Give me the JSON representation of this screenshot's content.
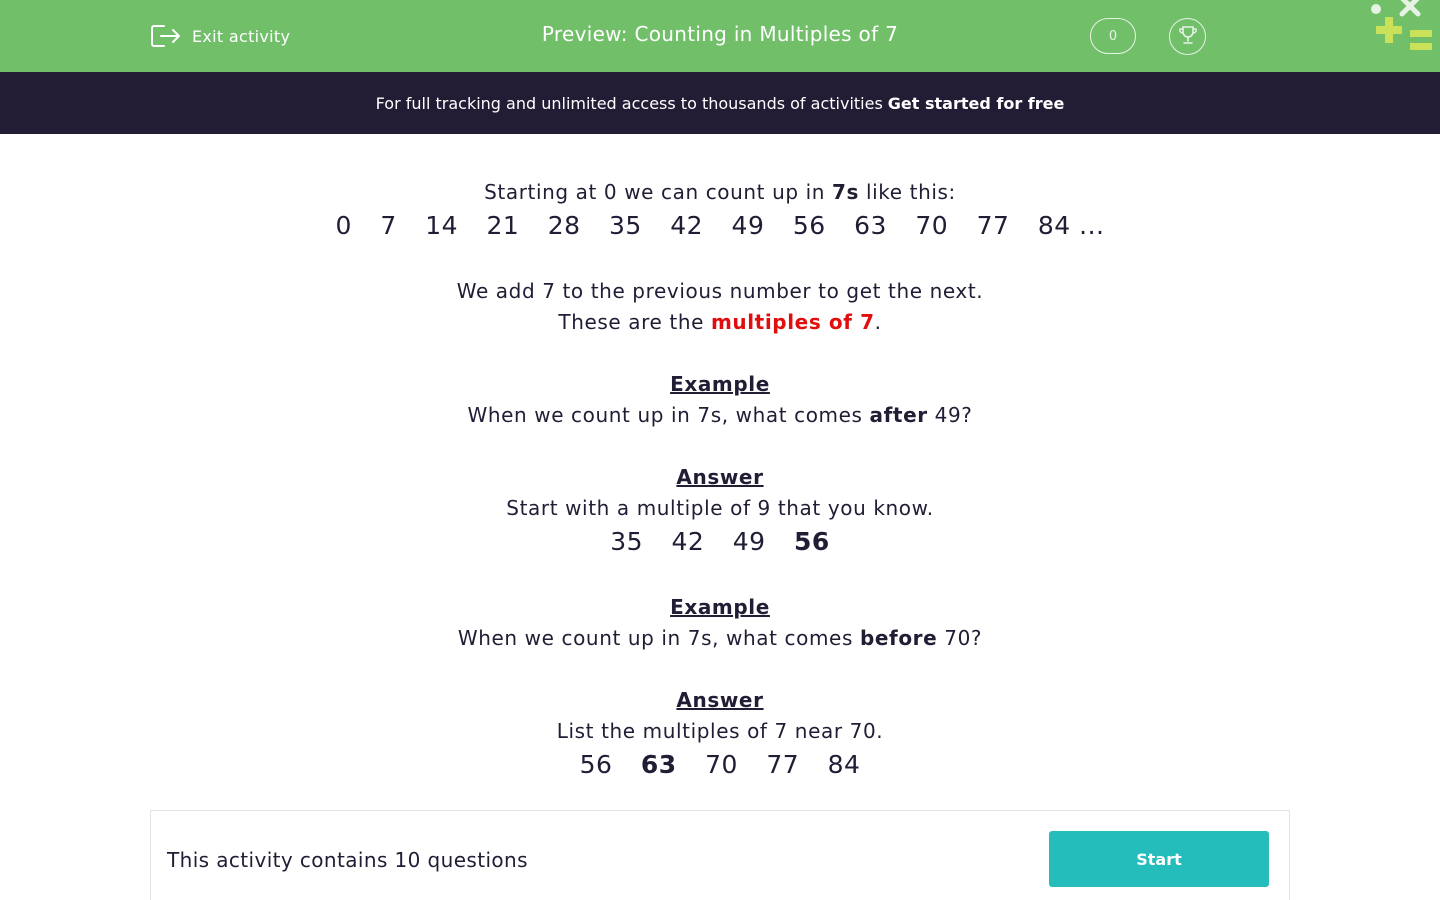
{
  "header": {
    "exit_label": "Exit activity",
    "title": "Preview: Counting in Multiples of 7",
    "score": "0"
  },
  "banner": {
    "text": "For full tracking and unlimited access to thousands of activities",
    "cta": "Get started for free"
  },
  "content": {
    "intro_pre": "Starting at 0 we can count up in ",
    "intro_bold": "7s",
    "intro_post": " like this:",
    "sequence": [
      "0",
      "7",
      "14",
      "21",
      "28",
      "35",
      "42",
      "49",
      "56",
      "63",
      "70",
      "77",
      "84 ..."
    ],
    "rule_line": "We add 7 to the previous number to get the next.",
    "multiples_pre": "These are the ",
    "multiples_highlight": "multiples of 7",
    "multiples_post": ".",
    "example1": {
      "heading": "Example",
      "question_pre": "When we count up in 7s, what comes ",
      "question_bold": "after",
      "question_post": " 49?",
      "answer_heading": "Answer",
      "answer_text": "Start with a multiple of 9 that you know.",
      "answer_numbers": [
        "35",
        "42",
        "49",
        "56"
      ]
    },
    "example2": {
      "heading": "Example",
      "question_pre": "When we count up in 7s, what comes ",
      "question_bold": "before",
      "question_post": " 70?",
      "answer_heading": "Answer",
      "answer_text": "List the multiples of 7 near 70.",
      "answer_numbers": [
        "56",
        "63",
        "70",
        "77",
        "84"
      ]
    }
  },
  "footer": {
    "question_count_text": "This activity contains 10 questions",
    "start_label": "Start"
  },
  "colors": {
    "header_green": "#72bf6a",
    "banner_navy": "#221c35",
    "highlight_red": "#e20d0d",
    "start_teal": "#25bcbc"
  }
}
